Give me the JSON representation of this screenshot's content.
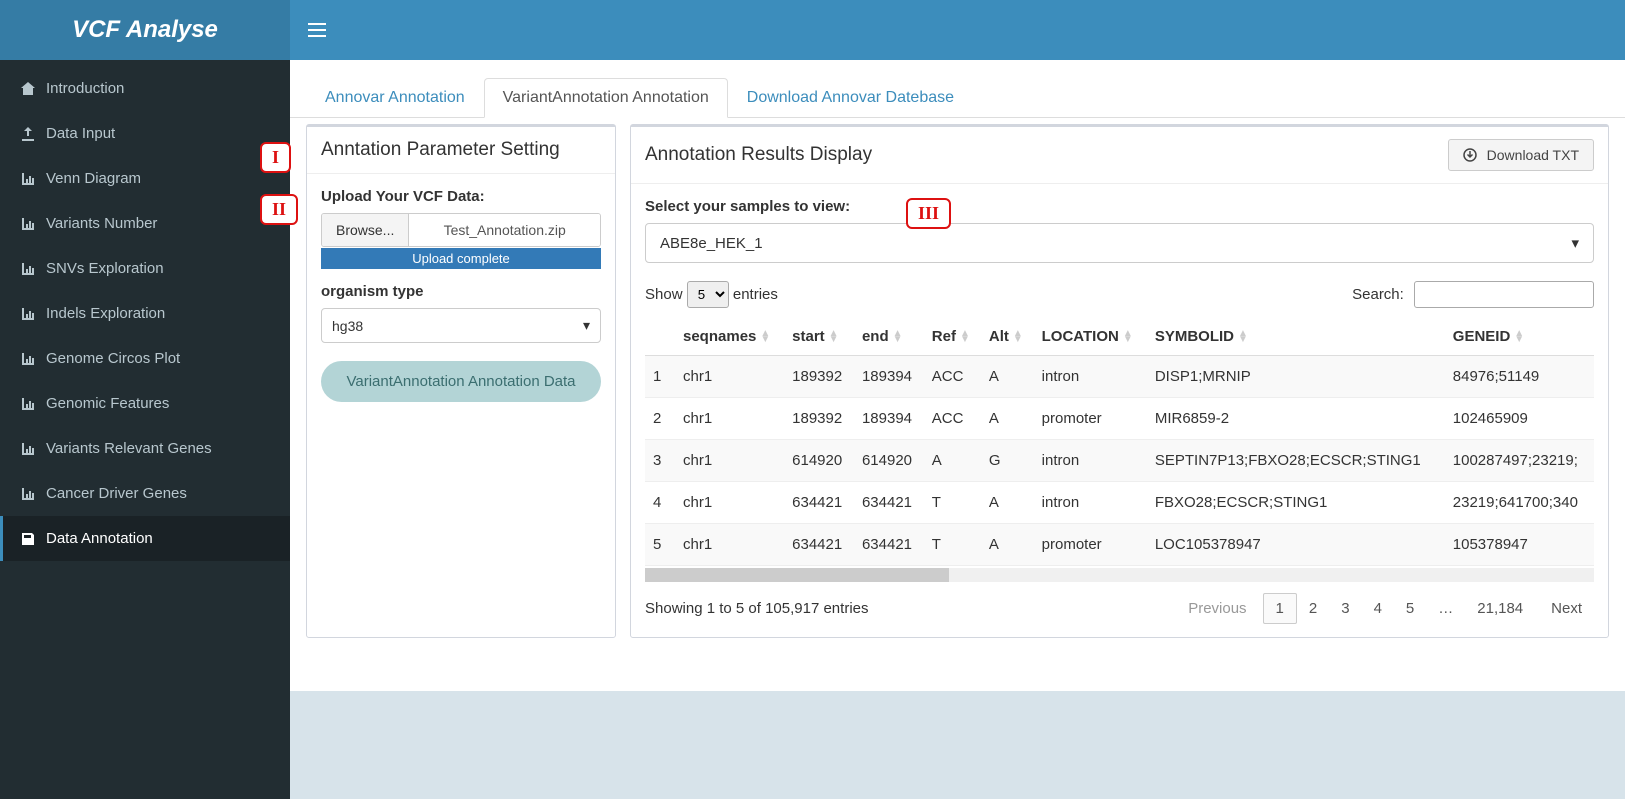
{
  "brand": "VCF Analyse",
  "sidebar": {
    "items": [
      {
        "label": "Introduction"
      },
      {
        "label": "Data Input"
      },
      {
        "label": "Venn Diagram"
      },
      {
        "label": "Variants Number"
      },
      {
        "label": "SNVs Exploration"
      },
      {
        "label": "Indels Exploration"
      },
      {
        "label": "Genome Circos Plot"
      },
      {
        "label": "Genomic Features"
      },
      {
        "label": "Variants Relevant Genes"
      },
      {
        "label": "Cancer Driver Genes"
      },
      {
        "label": "Data Annotation"
      }
    ]
  },
  "tabs": {
    "t0": "Annovar Annotation",
    "t1": "VariantAnnotation Annotation",
    "t2": "Download Annovar Datebase"
  },
  "callouts": {
    "i": "I",
    "ii": "II",
    "iii": "III"
  },
  "left_panel": {
    "title": "Anntation Parameter Setting",
    "upload_label": "Upload Your VCF Data:",
    "browse": "Browse...",
    "file_name": "Test_Annotation.zip",
    "progress_text": "Upload complete",
    "organism_label": "organism type",
    "organism_value": "hg38",
    "run_btn": "VariantAnnotation Annotation Data"
  },
  "right_panel": {
    "title": "Annotation Results Display",
    "download_btn": "Download TXT",
    "sample_label": "Select your samples to view:",
    "sample_value": "ABE8e_HEK_1",
    "show_label": "Show",
    "entries_value": "5",
    "entries_suffix": "entries",
    "search_label": "Search:",
    "search_value": "",
    "columns": [
      "seqnames",
      "start",
      "end",
      "Ref",
      "Alt",
      "LOCATION",
      "SYMBOLID",
      "GENEID"
    ],
    "rows": [
      {
        "idx": "1",
        "cells": [
          "chr1",
          "189392",
          "189394",
          "ACC",
          "A",
          "intron",
          "DISP1;MRNIP",
          "84976;51149"
        ]
      },
      {
        "idx": "2",
        "cells": [
          "chr1",
          "189392",
          "189394",
          "ACC",
          "A",
          "promoter",
          "MIR6859-2",
          "102465909"
        ]
      },
      {
        "idx": "3",
        "cells": [
          "chr1",
          "614920",
          "614920",
          "A",
          "G",
          "intron",
          "SEPTIN7P13;FBXO28;ECSCR;STING1",
          "100287497;23219;"
        ]
      },
      {
        "idx": "4",
        "cells": [
          "chr1",
          "634421",
          "634421",
          "T",
          "A",
          "intron",
          "FBXO28;ECSCR;STING1",
          "23219;641700;340"
        ]
      },
      {
        "idx": "5",
        "cells": [
          "chr1",
          "634421",
          "634421",
          "T",
          "A",
          "promoter",
          "LOC105378947",
          "105378947"
        ]
      }
    ],
    "info": "Showing 1 to 5 of 105,917 entries",
    "pagination": {
      "prev": "Previous",
      "pages": [
        "1",
        "2",
        "3",
        "4",
        "5",
        "…",
        "21,184"
      ],
      "next": "Next"
    }
  }
}
